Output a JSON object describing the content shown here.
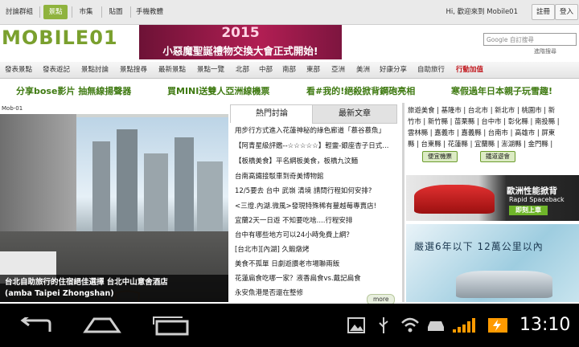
{
  "topnav": {
    "tabs": [
      "討論群組",
      "景點",
      "市集",
      "貼圖",
      "手機教體"
    ],
    "welcome": "Hi, 歡迎來到 Mobile01",
    "register": "註冊",
    "login": "登入"
  },
  "header": {
    "logo": "MOBILE01",
    "banner_year": "2015",
    "banner_text": "小惡魔聖誕禮物交換大會正式開始!",
    "search_placeholder": "Google 自訂搜尋",
    "search_label": "進階搜尋"
  },
  "subnav": [
    "發表景點",
    "發表遊記",
    "景點討論",
    "景點搜尋",
    "最新景點",
    "景點一覽",
    "北部",
    "中部",
    "南部",
    "東部",
    "亞洲",
    "美洲",
    "好康分享",
    "自助旅行",
    "行動加值"
  ],
  "promos": [
    "分享bose影片 抽無線揚聲器",
    "買MINI送雙人亞洲線機票",
    "看#我的!絕殺掀背鋼砲亮相",
    "寒假過年日本親子玩雪趣!"
  ],
  "hero": {
    "header_text": "Mob-01",
    "caption_line1": "台北自助旅行的住宿絕佳選擇 台北中山意舍酒店",
    "caption_line2": "(amba Taipei Zhongshan)"
  },
  "discussion": {
    "tab_hot": "熱門討論",
    "tab_new": "最新文章",
    "items": [
      "用步行方式進入花蓮神秘的綠色廊道「慕谷慕魚」",
      "【阿青星級評鑑--☆☆☆☆☆】輕靈-銀座杏子日式...",
      "【板橋美食】平名網板美食，板橋九汶麵",
      "台南高鐵接駁車到奇美博物館",
      "12/5要去 台中 武嶺 清境 請問行程如何安排?",
      "<三燈.內湖.微風>發現特殊稀有蔓越莓專賣店!",
      "宜蘭2天一日遊 不知要吃啥....行程安排",
      "台中有哪些地方可以24小時免費上網？",
      "[台北市][內湖] 久鍛燉烤",
      "美食不孤單 日劇遊讚老市場聯兩飯",
      "花蓮扁食吃哪一家？液香扁食vs.戴記扁食",
      "永安魚港是否還在整修"
    ],
    "more": "more"
  },
  "links": {
    "row1": "旅遊美食 | 基隆市 | 台北市 | 新北市 | 桃園市 | 新",
    "row2": "竹市 | 新竹縣 | 苗栗縣 | 台中市 | 彰化縣 | 南投縣 |",
    "row3": "雲林縣 | 嘉義市 | 嘉義縣 | 台南市 | 高雄市 | 屏東",
    "row4": "縣 | 台東縣 | 花蓮縣 | 宜蘭縣 | 澎湖縣 | 金門縣 |",
    "btn_ticket": "便宜機票",
    "btn_cruise": "鐵道遊會"
  },
  "ads": {
    "skoda_title": "歐洲性能掀背",
    "skoda_model": "Rapid Spaceback",
    "skoda_cta": "即刻上車",
    "ad2_text": "嚴選6年以下 12萬公里以內"
  },
  "statusbar": {
    "clock": "13:10"
  }
}
